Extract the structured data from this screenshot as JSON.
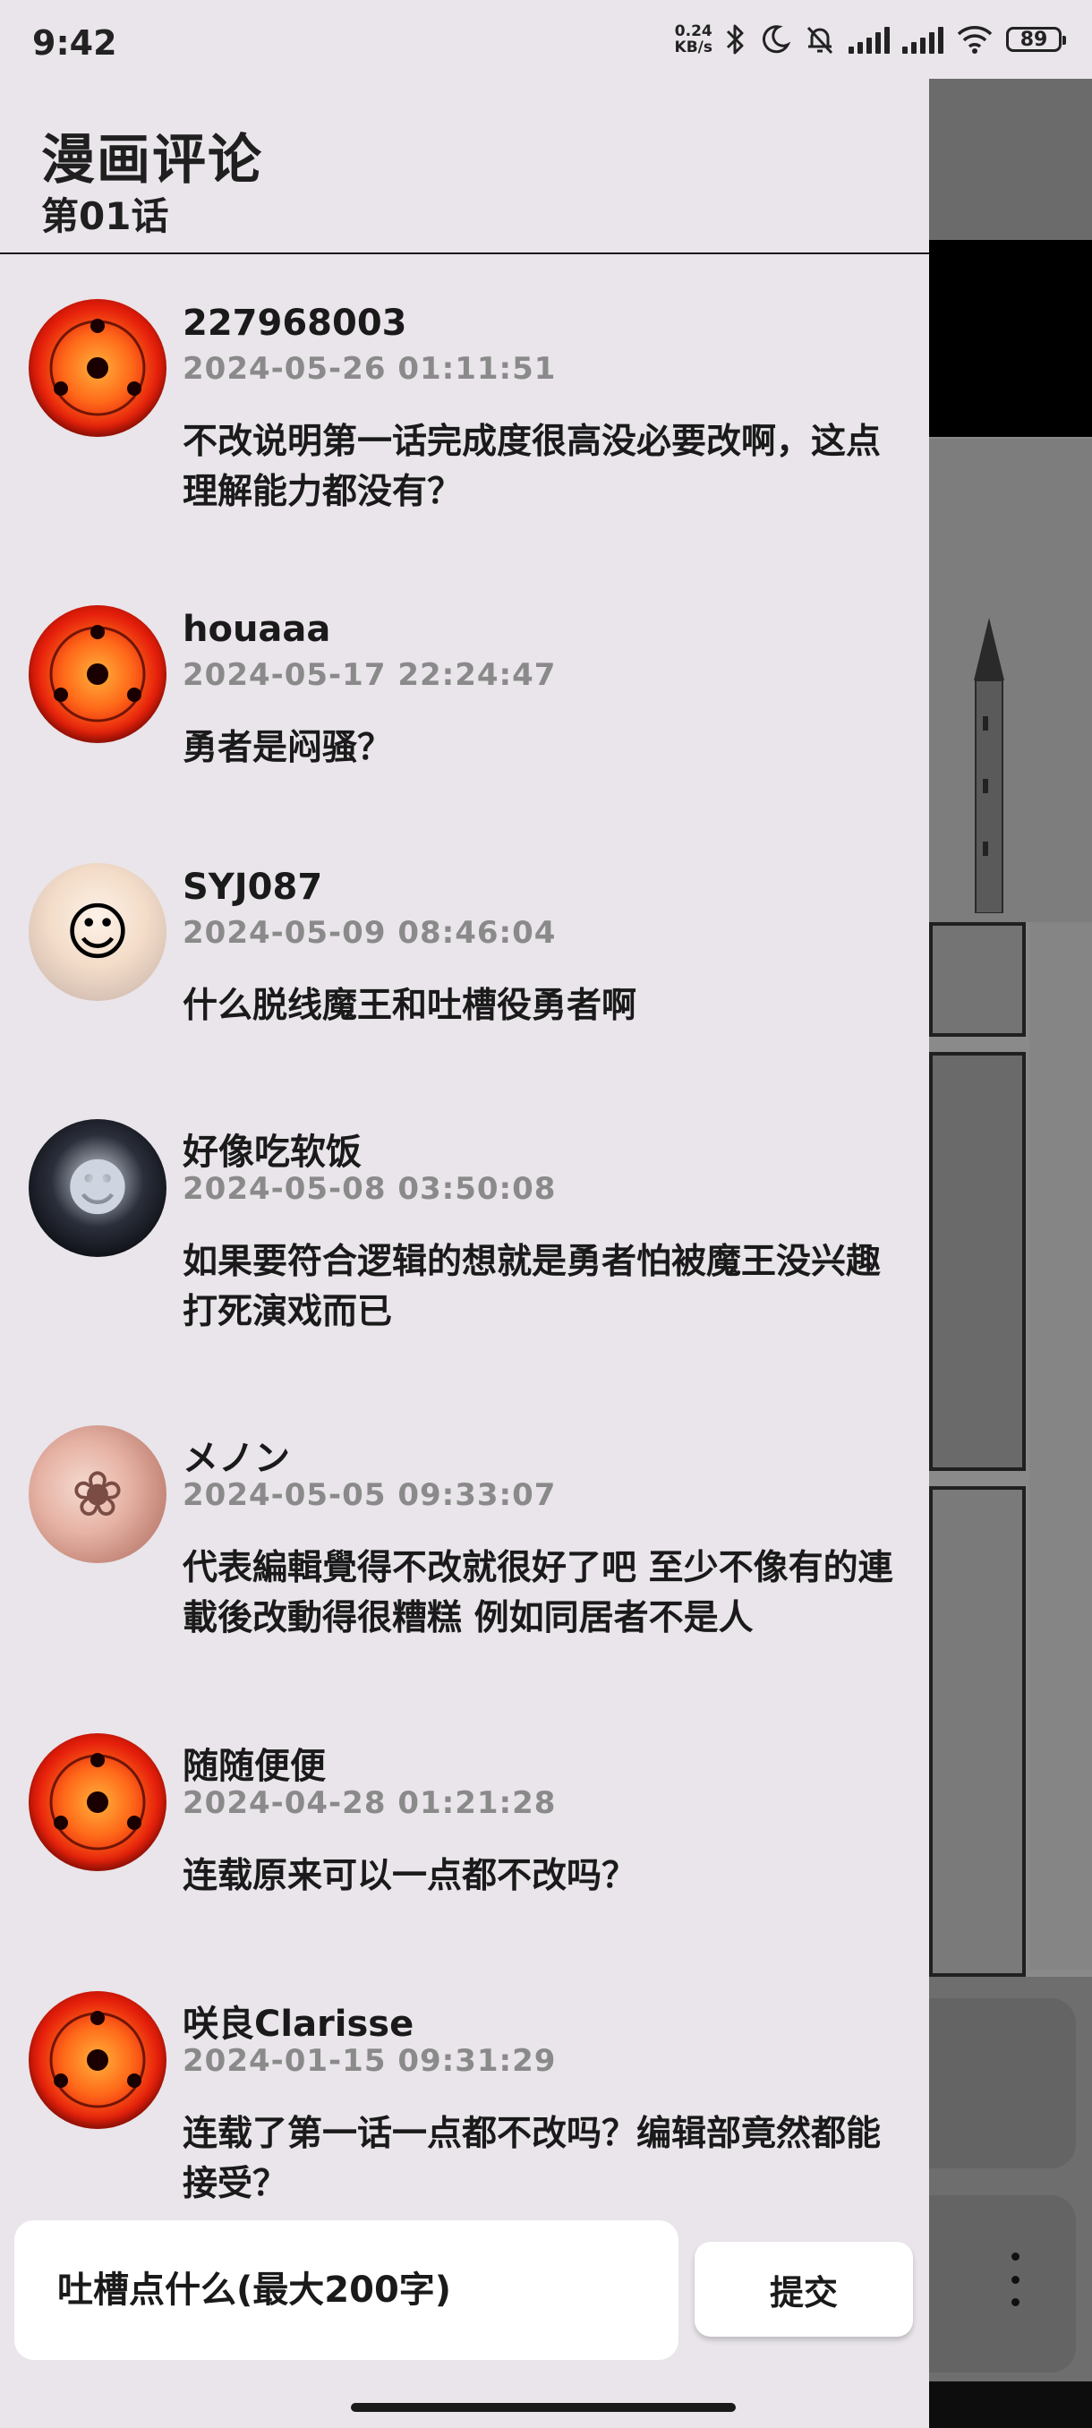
{
  "status_bar": {
    "time": "9:42",
    "net_speed_value": "0.24",
    "net_speed_unit": "KB/s",
    "battery": "89"
  },
  "drawer": {
    "title": "漫画评论",
    "subtitle": "第01话"
  },
  "comments": [
    {
      "name": "227968003",
      "date": "2024-05-26 01:11:51",
      "text": "不改说明第一话完成度很高没必要改啊，这点理解能力都没有？",
      "avatar": "sharingan-avatar"
    },
    {
      "name": "houaaa",
      "date": "2024-05-17 22:24:47",
      "text": "勇者是闷骚？",
      "avatar": "sharingan-avatar"
    },
    {
      "name": "SYJ087",
      "date": "2024-05-09 08:46:04",
      "text": "什么脱线魔王和吐槽役勇者啊",
      "avatar": "anime-girl-avatar"
    },
    {
      "name": "好像吃软饭",
      "date": "2024-05-08 03:50:08",
      "text": "如果要符合逻辑的想就是勇者怕被魔王没兴趣打死演戏而已",
      "avatar": "anime-dark-hair-avatar"
    },
    {
      "name": "メノン",
      "date": "2024-05-05 09:33:07",
      "text": "代表編輯覺得不改就很好了吧 至少不像有的連載後改動得很糟糕 例如同居者不是人",
      "avatar": "anime-duo-avatar"
    },
    {
      "name": "随随便便",
      "date": "2024-04-28 01:21:28",
      "text": "连载原来可以一点都不改吗？",
      "avatar": "sharingan-avatar"
    },
    {
      "name": "咲良Clarisse",
      "date": "2024-01-15 09:31:29",
      "text": "连载了第一话一点都不改吗？编辑部竟然都能接受？",
      "avatar": "sharingan-avatar"
    }
  ],
  "input": {
    "placeholder": "吐槽点什么(最大200字)"
  },
  "submit_label": "提交",
  "icons": {
    "bluetooth": "bluetooth-icon",
    "moon": "moon-icon",
    "bell_off": "bell-off-icon",
    "wifi": "wifi-icon",
    "more": "more-vertical-icon"
  }
}
